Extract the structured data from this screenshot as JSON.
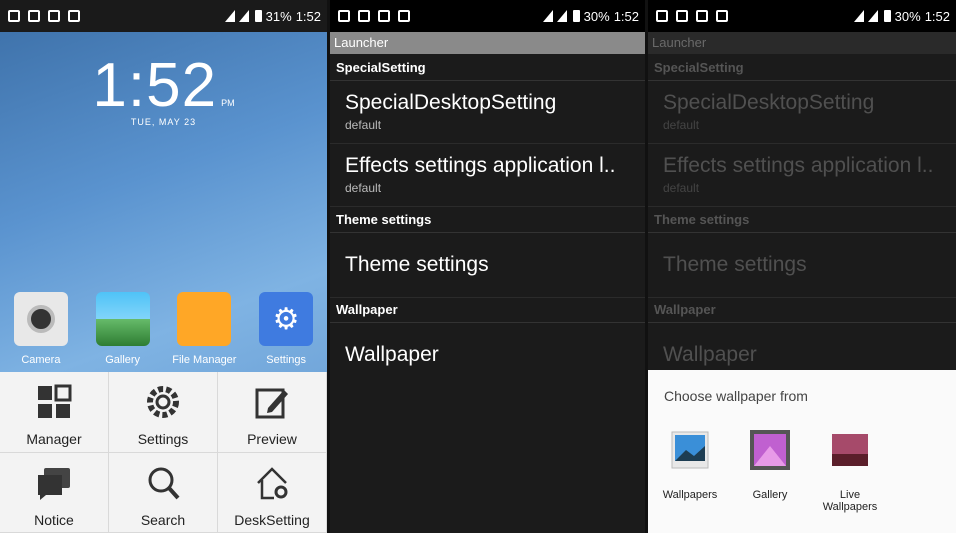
{
  "left": {
    "statusbar": {
      "battery": "31%",
      "time": "1:52"
    },
    "clock": {
      "time": "1:52",
      "ampm": "PM",
      "date": "TUE, MAY 23"
    },
    "apps": [
      {
        "label": "Camera"
      },
      {
        "label": "Gallery"
      },
      {
        "label": "File Manager"
      },
      {
        "label": "Settings"
      }
    ],
    "menu": [
      {
        "label": "Manager"
      },
      {
        "label": "Settings"
      },
      {
        "label": "Preview"
      },
      {
        "label": "Notice"
      },
      {
        "label": "Search"
      },
      {
        "label": "DeskSetting"
      }
    ]
  },
  "middle": {
    "statusbar": {
      "battery": "30%",
      "time": "1:52"
    },
    "title": "Launcher",
    "sections": [
      {
        "label": "SpecialSetting"
      },
      {
        "label": "Theme settings"
      },
      {
        "label": "Wallpaper"
      }
    ],
    "items": [
      {
        "title": "SpecialDesktopSetting",
        "subtitle": "default"
      },
      {
        "title": "Effects settings application l..",
        "subtitle": "default"
      },
      {
        "title": "Theme settings"
      },
      {
        "title": "Wallpaper"
      }
    ]
  },
  "right": {
    "statusbar": {
      "battery": "30%",
      "time": "1:52"
    },
    "title": "Launcher",
    "sections": [
      {
        "label": "SpecialSetting"
      },
      {
        "label": "Theme settings"
      },
      {
        "label": "Wallpaper"
      }
    ],
    "items": [
      {
        "title": "SpecialDesktopSetting",
        "subtitle": "default"
      },
      {
        "title": "Effects settings application l..",
        "subtitle": "default"
      },
      {
        "title": "Theme settings"
      },
      {
        "title": "Wallpaper"
      }
    ],
    "dialog": {
      "title": "Choose wallpaper from",
      "choices": [
        {
          "label": "Wallpapers"
        },
        {
          "label": "Gallery"
        },
        {
          "label": "Live Wallpapers"
        }
      ]
    }
  }
}
